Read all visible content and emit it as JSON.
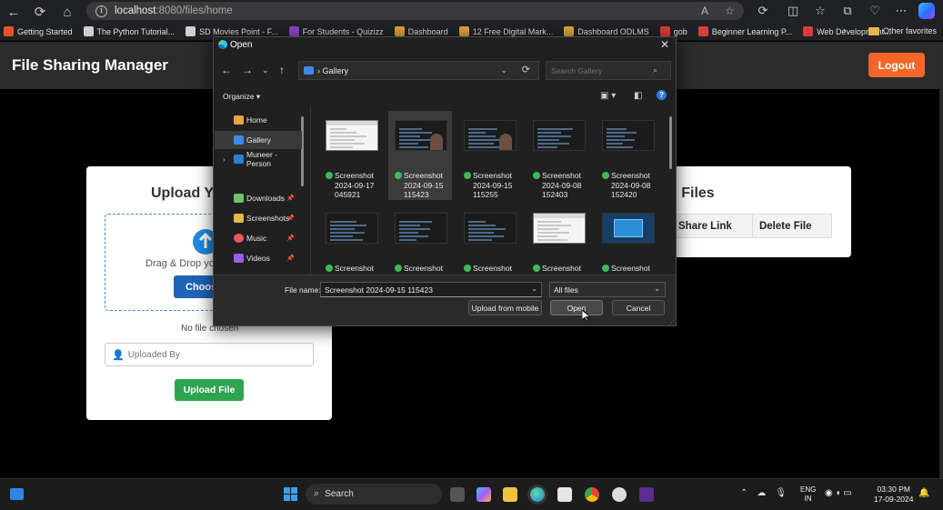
{
  "browser": {
    "url_host": "localhost",
    "url_path": ":8080/files/home",
    "bookmarks": [
      {
        "label": "Getting Started",
        "color": "#e8532b"
      },
      {
        "label": "The Python Tutorial...",
        "color": "#d0d0d0"
      },
      {
        "label": "SD Movies Point - F...",
        "color": "#d0d0d0"
      },
      {
        "label": "For Students - Quizizz",
        "color": "#8a45c9"
      },
      {
        "label": "Dashboard",
        "color": "#d9a43a"
      },
      {
        "label": "12 Free Digital Mark...",
        "color": "#d9a43a"
      },
      {
        "label": "Dashboard ODLMS",
        "color": "#d9a43a"
      },
      {
        "label": "gob",
        "color": "#d93c3c"
      },
      {
        "label": "Beginner Learning P...",
        "color": "#d93c3c"
      },
      {
        "label": "Web Development...",
        "color": "#d93c3c"
      }
    ],
    "other_favorites": "Other favorites"
  },
  "app": {
    "title": "File Sharing Manager",
    "logout": "Logout",
    "upload": {
      "title": "Upload Y",
      "drop_text": "Drag & Drop yo",
      "choose_btn": "Choose",
      "no_file": "No file chosen",
      "uploaded_by_placeholder": "Uploaded By",
      "upload_btn": "Upload File"
    },
    "files": {
      "title": "d Files",
      "columns": [
        "Share Link",
        "Delete File"
      ]
    }
  },
  "dialog": {
    "title": "Open",
    "path": "Gallery",
    "search_placeholder": "Search Gallery",
    "organize": "Organize",
    "sidebar": [
      "Home",
      "Gallery",
      "Muneer - Person",
      "Downloads",
      "Screenshots",
      "Music",
      "Videos"
    ],
    "tiles": [
      {
        "line1": "Screenshot",
        "line2": "2024-09-17",
        "line3": "045921"
      },
      {
        "line1": "Screenshot",
        "line2": "2024-09-15",
        "line3": "115423"
      },
      {
        "line1": "Screenshot",
        "line2": "2024-09-15",
        "line3": "115255"
      },
      {
        "line1": "Screenshot",
        "line2": "2024-09-08",
        "line3": "152403"
      },
      {
        "line1": "Screenshot",
        "line2": "2024-09-08",
        "line3": "152420"
      },
      {
        "line1": "Screenshot",
        "line2": "",
        "line3": ""
      },
      {
        "line1": "Screenshot",
        "line2": "",
        "line3": ""
      },
      {
        "line1": "Screenshot",
        "line2": "",
        "line3": ""
      },
      {
        "line1": "Screenshot",
        "line2": "",
        "line3": ""
      },
      {
        "line1": "Screenshot",
        "line2": "",
        "line3": ""
      }
    ],
    "filename_label": "File name:",
    "filename_value": "Screenshot 2024-09-15 115423",
    "filetype": "All files",
    "upload_mobile": "Upload from mobile",
    "open": "Open",
    "cancel": "Cancel"
  },
  "taskbar": {
    "search": "Search",
    "lang1": "ENG",
    "lang2": "IN",
    "time": "03:30 PM",
    "date": "17-09-2024"
  }
}
